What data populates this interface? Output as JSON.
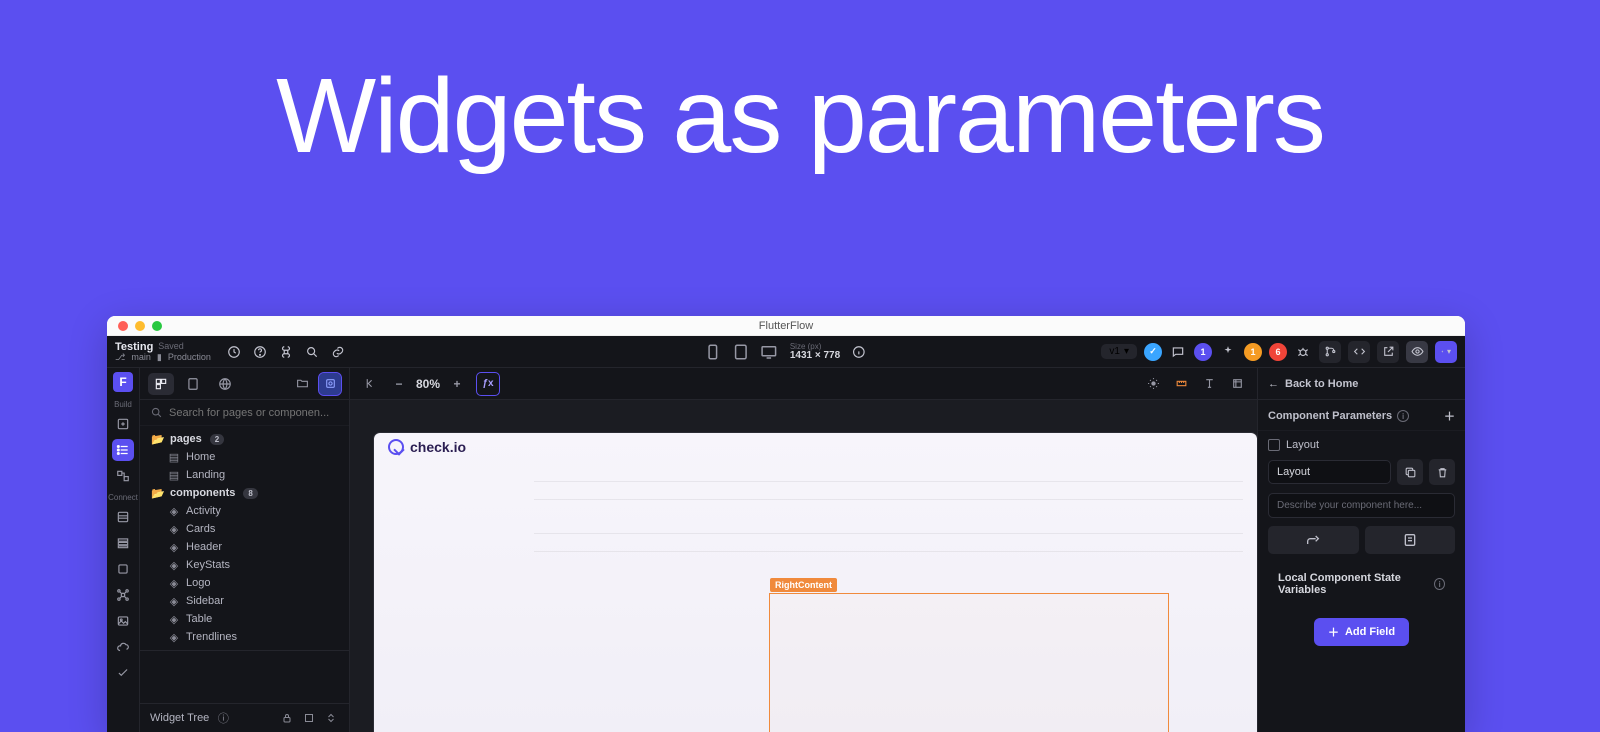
{
  "slide": {
    "title": "Widgets as parameters"
  },
  "window": {
    "title": "FlutterFlow"
  },
  "project": {
    "name": "Testing",
    "status": "Saved",
    "branch_icon": "⎇",
    "branch": "main",
    "env_icon": "▮",
    "env": "Production"
  },
  "topbar": {
    "size_label": "Size (px)",
    "size_value": "1431 × 778",
    "version": "v1",
    "badge_purple": "1",
    "badge_orange": "1",
    "badge_red": "6"
  },
  "rail": {
    "section1": "Build",
    "section2": "Connect"
  },
  "leftpanel": {
    "search_placeholder": "Search for pages or componen...",
    "pages_label": "pages",
    "pages_count": "2",
    "pages": [
      "Home",
      "Landing"
    ],
    "components_label": "components",
    "components_count": "8",
    "components": [
      "Activity",
      "Cards",
      "Header",
      "KeyStats",
      "Logo",
      "Sidebar",
      "Table",
      "Trendlines"
    ],
    "widget_tree": "Widget Tree"
  },
  "canvas": {
    "zoom": "80%",
    "brand": "check.io",
    "selection_label": "RightContent"
  },
  "rightpanel": {
    "back": "Back to Home",
    "section_params": "Component Parameters",
    "layout_chk": "Layout",
    "layout_field": "Layout",
    "desc_placeholder": "Describe your component here...",
    "section_state": "Local Component State Variables",
    "add_field": "Add Field"
  }
}
